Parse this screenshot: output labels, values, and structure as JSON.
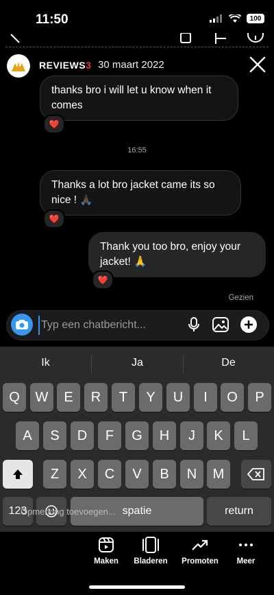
{
  "status": {
    "time": "11:50",
    "battery": "100"
  },
  "header": {
    "name": "REVIEWS",
    "badge": "3",
    "date": "30 maart 2022"
  },
  "messages": [
    {
      "text": "thanks bro i will let u know when it comes",
      "reaction": "❤️"
    },
    {
      "text": "Thanks a lot bro jacket came its so nice ! 🙏🏿",
      "reaction": "❤️"
    },
    {
      "text": "Thank you too bro, enjoy your jacket! 🙏",
      "reaction": "❤️"
    }
  ],
  "timestamp": "16:55",
  "seen": "Gezien",
  "composer": {
    "placeholder": "Typ een chatbericht..."
  },
  "keyboard": {
    "suggestions": [
      "Ik",
      "Ja",
      "De"
    ],
    "row1": [
      "Q",
      "W",
      "E",
      "R",
      "T",
      "Y",
      "U",
      "I",
      "O",
      "P"
    ],
    "row2": [
      "A",
      "S",
      "D",
      "F",
      "G",
      "H",
      "J",
      "K",
      "L"
    ],
    "row3": [
      "Z",
      "X",
      "C",
      "V",
      "B",
      "N",
      "M"
    ],
    "numbers": "123",
    "space": "spatie",
    "return": "return",
    "dictation": "Opmerking toevoegen..."
  },
  "actions": [
    {
      "label": "Maken",
      "icon": "reel-icon"
    },
    {
      "label": "Bladeren",
      "icon": "carousel-icon"
    },
    {
      "label": "Promoten",
      "icon": "trending-icon"
    },
    {
      "label": "Meer",
      "icon": "more-icon"
    }
  ],
  "colors": {
    "accent": "#3797f0",
    "heart": "#e0245e",
    "background": "#000000"
  }
}
